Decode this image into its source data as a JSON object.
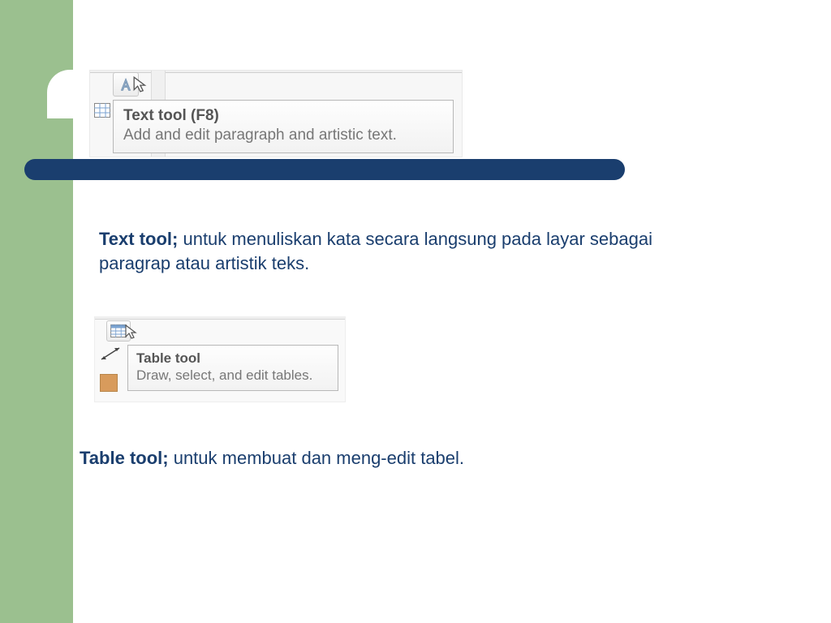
{
  "tooltip1": {
    "title": "Text tool (F8)",
    "body": "Add and edit paragraph and artistic text."
  },
  "para1": {
    "label": "Text tool; ",
    "body": "untuk menuliskan kata secara langsung pada layar sebagai paragrap atau artistik teks."
  },
  "tooltip2": {
    "title": "Table tool",
    "body": "Draw, select, and edit tables."
  },
  "para2": {
    "label": "Table tool; ",
    "body": "untuk membuat dan meng-edit tabel."
  }
}
